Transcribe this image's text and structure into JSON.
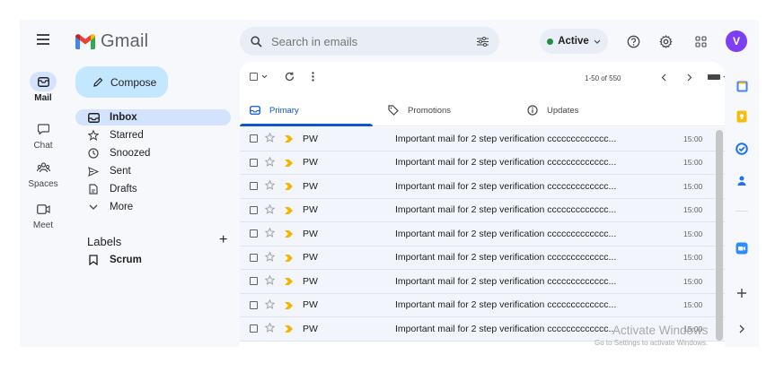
{
  "app": {
    "name": "Gmail"
  },
  "rail": [
    {
      "label": "Mail",
      "icon": "mail-icon",
      "active": true
    },
    {
      "label": "Chat",
      "icon": "chat-icon",
      "active": false
    },
    {
      "label": "Spaces",
      "icon": "spaces-icon",
      "active": false
    },
    {
      "label": "Meet",
      "icon": "meet-icon",
      "active": false
    }
  ],
  "compose": {
    "label": "Compose"
  },
  "nav": [
    {
      "label": "Inbox",
      "icon": "inbox-icon",
      "active": true
    },
    {
      "label": "Starred",
      "icon": "star-icon",
      "active": false
    },
    {
      "label": "Snoozed",
      "icon": "clock-icon",
      "active": false
    },
    {
      "label": "Sent",
      "icon": "send-icon",
      "active": false
    },
    {
      "label": "Drafts",
      "icon": "draft-icon",
      "active": false
    },
    {
      "label": "More",
      "icon": "chevron-down-icon",
      "active": false
    }
  ],
  "labels": {
    "heading": "Labels",
    "add": "+",
    "items": [
      {
        "label": "Scrum",
        "icon": "label-icon"
      }
    ]
  },
  "search": {
    "placeholder": "Search in emails"
  },
  "status": {
    "label": "Active",
    "color": "#1e8e3e"
  },
  "account": {
    "initial": "V",
    "color": "#7e3ff2"
  },
  "toolbar": {
    "paging": "1-50 of 550"
  },
  "tabs": [
    {
      "label": "Primary",
      "icon": "inbox-icon",
      "active": true
    },
    {
      "label": "Promotions",
      "icon": "tag-icon",
      "active": false
    },
    {
      "label": "Updates",
      "icon": "info-icon",
      "active": false
    }
  ],
  "emails": [
    {
      "sender": "PW",
      "subject": "Important mail for 2 step verification ccccccccccccc...",
      "time": "15:00"
    },
    {
      "sender": "PW",
      "subject": "Important mail for 2 step verification ccccccccccccc...",
      "time": "15:00"
    },
    {
      "sender": "PW",
      "subject": "Important mail for 2 step verification ccccccccccccc...",
      "time": "15:00"
    },
    {
      "sender": "PW",
      "subject": "Important mail for 2 step verification ccccccccccccc...",
      "time": "15:00"
    },
    {
      "sender": "PW",
      "subject": "Important mail for 2 step verification ccccccccccccc...",
      "time": "15:00"
    },
    {
      "sender": "PW",
      "subject": "Important mail for 2 step verification ccccccccccccc...",
      "time": "15:00"
    },
    {
      "sender": "PW",
      "subject": "Important mail for 2 step verification ccccccccccccc...",
      "time": "15:00"
    },
    {
      "sender": "PW",
      "subject": "Important mail for 2 step verification ccccccccccccc...",
      "time": "15:00"
    },
    {
      "sender": "PW",
      "subject": "Important mail for 2 step verification ccccccccccccc...",
      "time": "15:00"
    }
  ],
  "watermark": {
    "title": "Activate Windows",
    "subtitle": "Go to Settings to activate Windows."
  },
  "colors": {
    "accent": "#0b57d0",
    "important": "#f4b400",
    "compose_bg": "#c2e7ff",
    "selected_nav": "#d3e3fd"
  }
}
